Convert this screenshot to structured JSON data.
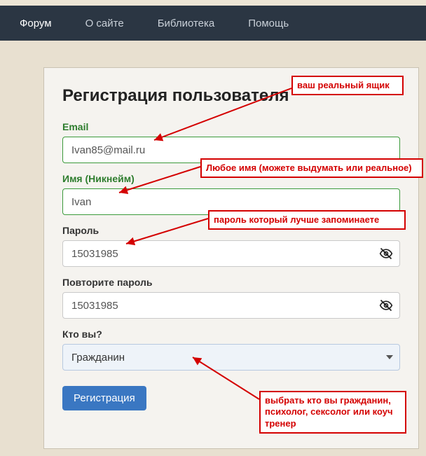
{
  "nav": {
    "items": [
      "Форум",
      "О сайте",
      "Библиотека",
      "Помощь"
    ]
  },
  "title": "Регистрация пользователя",
  "form": {
    "email_label": "Email",
    "email_value": "Ivan85@mail.ru",
    "name_label": "Имя (Никнейм)",
    "name_value": "Ivan",
    "password_label": "Пароль",
    "password_value": "15031985",
    "password2_label": "Повторите пароль",
    "password2_value": "15031985",
    "who_label": "Кто вы?",
    "who_value": "Гражданин",
    "submit": "Регистрация"
  },
  "annotations": {
    "a1": "ваш реальный ящик",
    "a2": "Любое имя (можете выдумать или реальное)",
    "a3": "пароль который лучше запоминаете",
    "a4": "выбрать кто вы гражданин, психолог, сексолог или коуч тренер"
  }
}
